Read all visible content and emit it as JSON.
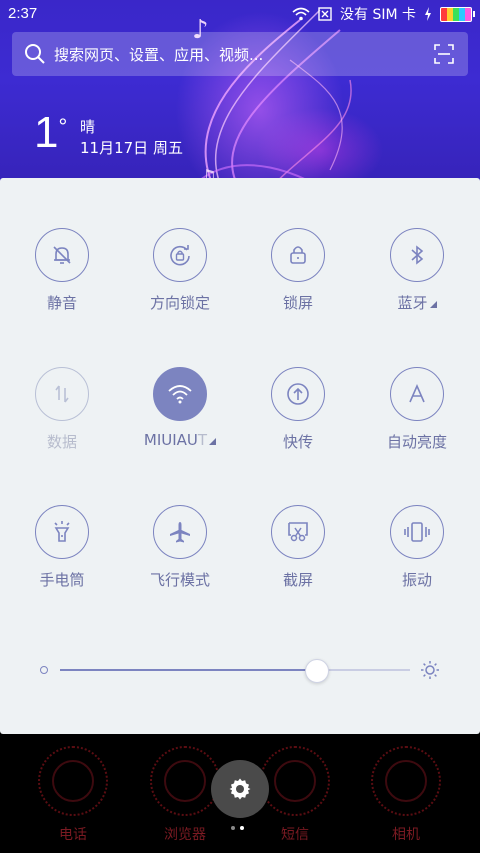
{
  "status_bar": {
    "time": "2:37",
    "carrier": "没有 SIM 卡",
    "icons": [
      "wifi-icon",
      "no-sim-icon",
      "charging-icon",
      "battery-icon"
    ]
  },
  "search": {
    "placeholder": "搜索网页、设置、应用、视频..."
  },
  "weather": {
    "temperature": "1",
    "degree_symbol": "°",
    "condition": "晴",
    "date": "11月17日 周五"
  },
  "quick_settings": {
    "tiles": [
      {
        "label": "静音",
        "icon": "silent-bell-icon",
        "state": "off"
      },
      {
        "label": "方向锁定",
        "icon": "rotation-lock-icon",
        "state": "off"
      },
      {
        "label": "锁屏",
        "icon": "lock-icon",
        "state": "off"
      },
      {
        "label": "蓝牙",
        "icon": "bluetooth-icon",
        "state": "off",
        "has_menu": true
      },
      {
        "label": "数据",
        "icon": "mobile-data-icon",
        "state": "disabled"
      },
      {
        "label_main": "MIUIAU",
        "label_fade": "T",
        "icon": "wifi-icon",
        "state": "on",
        "has_menu": true
      },
      {
        "label": "快传",
        "icon": "quick-transfer-icon",
        "state": "off"
      },
      {
        "label": "自动亮度",
        "icon": "auto-brightness-icon",
        "state": "off"
      },
      {
        "label": "手电筒",
        "icon": "flashlight-icon",
        "state": "off"
      },
      {
        "label": "飞行模式",
        "icon": "airplane-icon",
        "state": "off"
      },
      {
        "label": "截屏",
        "icon": "screenshot-icon",
        "state": "off"
      },
      {
        "label": "振动",
        "icon": "vibrate-icon",
        "state": "off"
      }
    ],
    "brightness_level": 0.73
  },
  "dock": {
    "apps": [
      "电话",
      "浏览器",
      "短信",
      "相机"
    ]
  },
  "colors": {
    "accent": "#7c84c0",
    "panel_bg": "#eef2f4",
    "wallpaper": "#3a27c9"
  }
}
